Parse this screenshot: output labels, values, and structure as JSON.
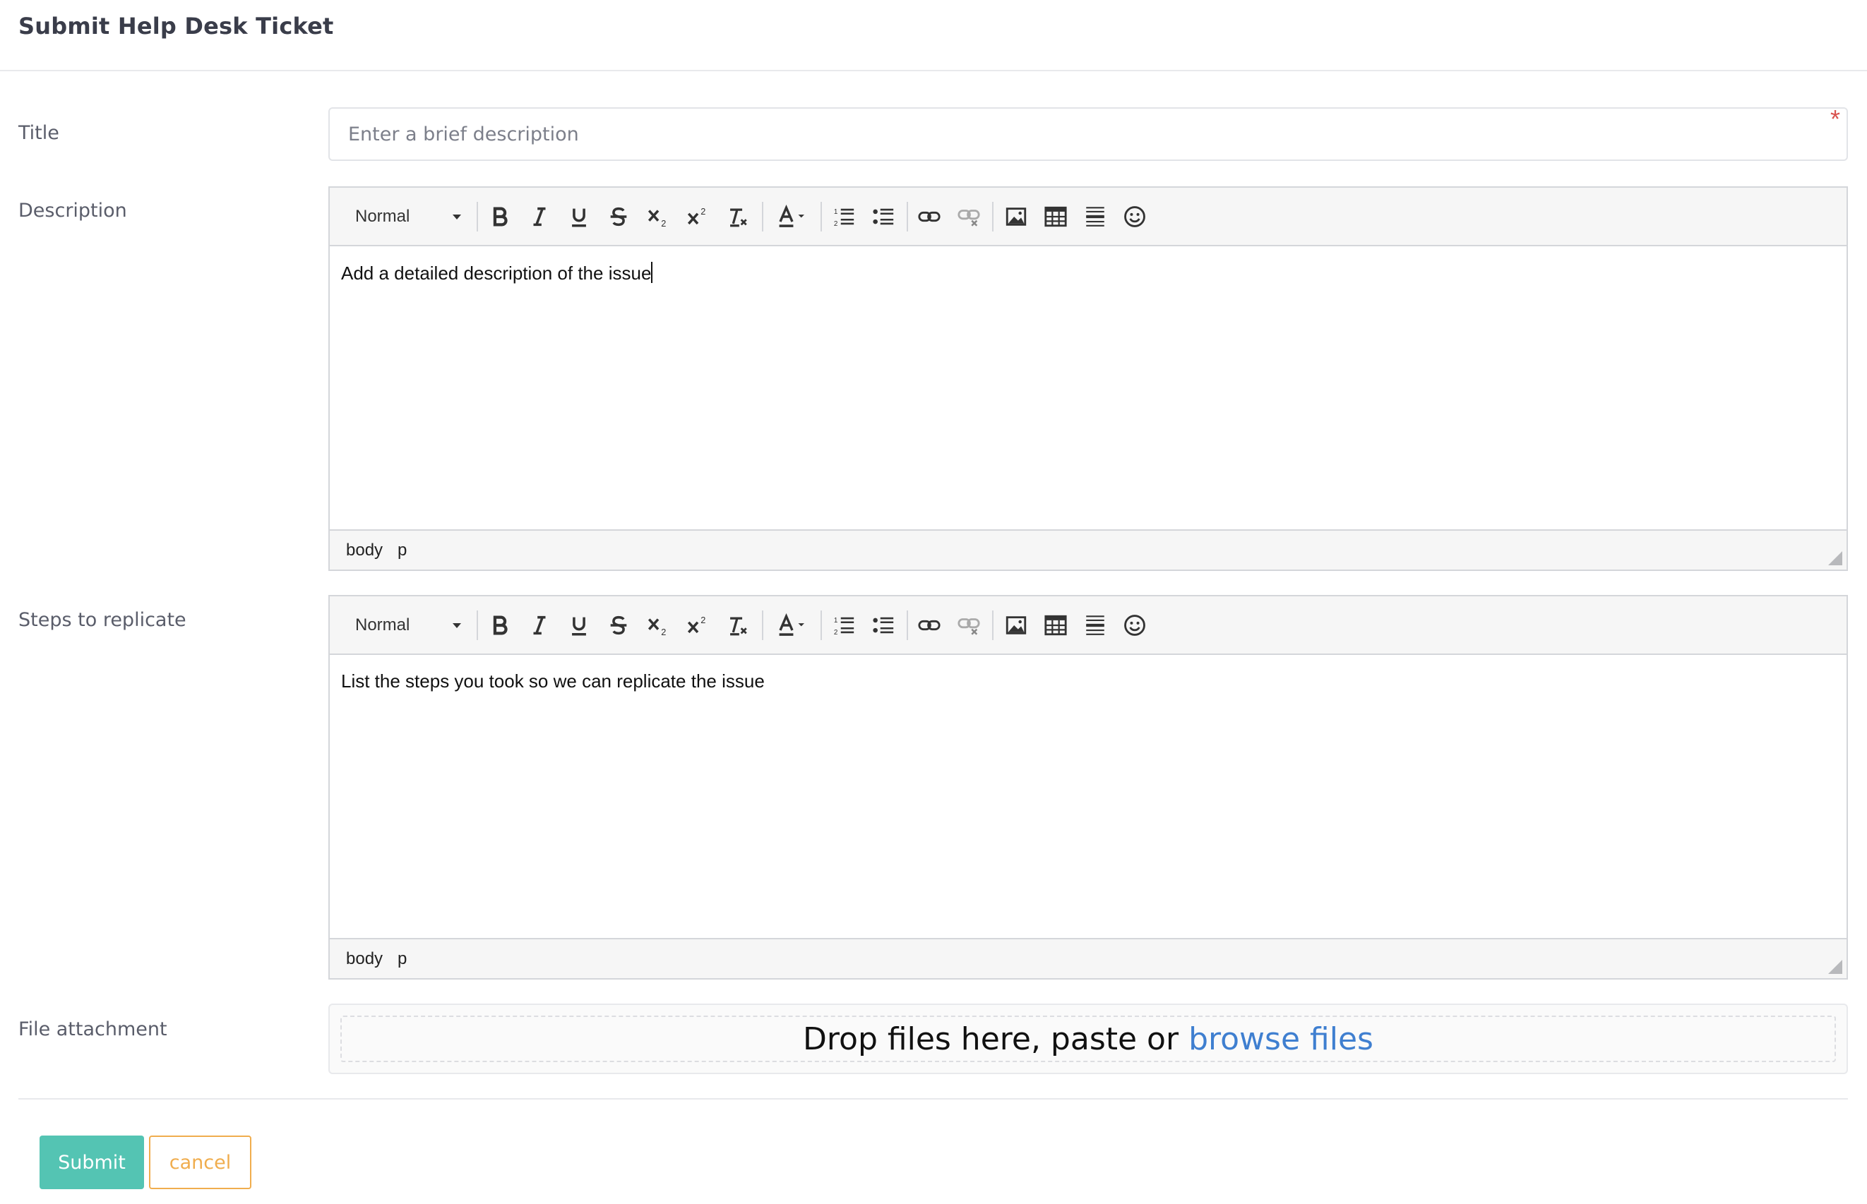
{
  "page": {
    "title": "Submit Help Desk Ticket"
  },
  "fields": {
    "title": {
      "label": "Title",
      "placeholder": "Enter a brief description",
      "value": "",
      "required_mark": "*"
    },
    "description": {
      "label": "Description",
      "format": "Normal",
      "content": "Add a detailed description of the issue",
      "path": [
        "body",
        "p"
      ]
    },
    "steps": {
      "label": "Steps to replicate",
      "format": "Normal",
      "content": "List the steps you took so we can replicate the issue",
      "path": [
        "body",
        "p"
      ]
    },
    "attachment": {
      "label": "File attachment",
      "drop_text": "Drop files here, paste or ",
      "browse_text": "browse files"
    }
  },
  "toolbar": {
    "icons": [
      "bold-icon",
      "italic-icon",
      "underline-icon",
      "strikethrough-icon",
      "subscript-icon",
      "superscript-icon",
      "clear-format-icon",
      "text-color-icon",
      "numbered-list-icon",
      "bullet-list-icon",
      "link-icon",
      "unlink-icon",
      "image-icon",
      "table-icon",
      "horizontal-rule-icon",
      "emoji-icon"
    ]
  },
  "actions": {
    "submit_label": "Submit",
    "cancel_label": "cancel"
  },
  "colors": {
    "submit": "#54c4b3",
    "cancel": "#f0ad4e",
    "link": "#3f7fd0",
    "required": "#d9534f"
  }
}
